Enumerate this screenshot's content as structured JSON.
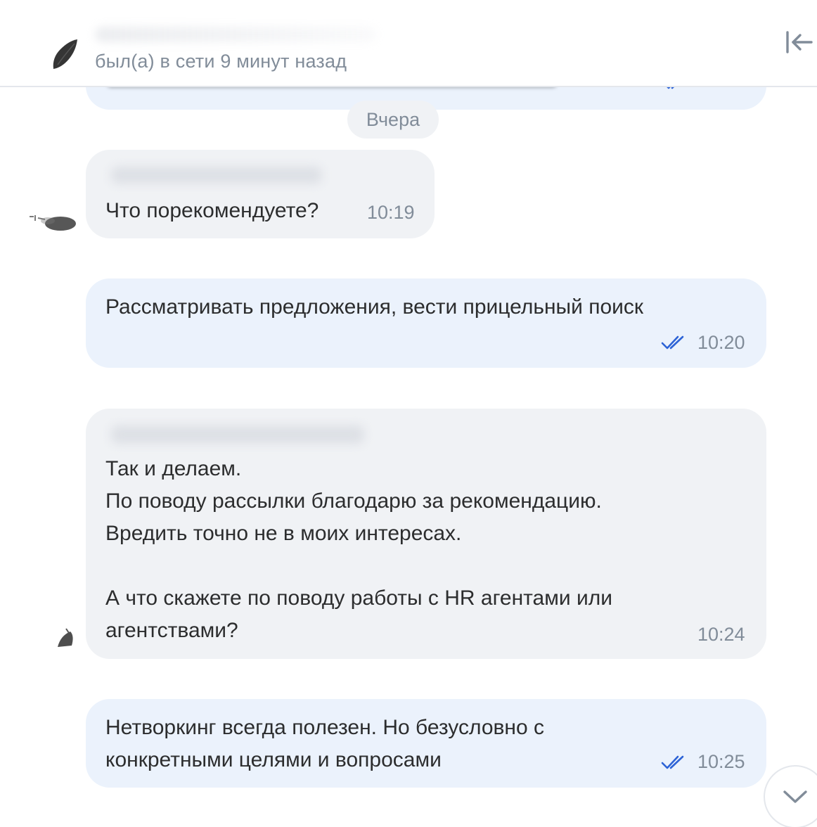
{
  "header": {
    "status": "был(а) в сети 9 минут назад"
  },
  "date_separator": "Вчера",
  "messages": [
    {
      "direction": "incoming",
      "lines": [
        "Что порекомендуете?"
      ],
      "time": "10:19"
    },
    {
      "direction": "outgoing",
      "lines": [
        "Рассматривать предложения, вести прицельный поиск"
      ],
      "time": "10:20",
      "read": true
    },
    {
      "direction": "incoming",
      "lines": [
        "Так и делаем.",
        "По поводу рассылки благодарю за рекомендацию.",
        "Вредить точно не в моих интересах.",
        "",
        "А что скажете по поводу работы с HR агентами или",
        "агентствами?"
      ],
      "time": "10:24"
    },
    {
      "direction": "outgoing",
      "lines": [
        "Нетворкинг всегда полезен. Но безусловно с",
        "конкретными целями и вопросами"
      ],
      "time": "10:25",
      "read": true
    }
  ],
  "colors": {
    "incoming_bubble": "#f0f2f5",
    "outgoing_bubble": "#ebf2fc",
    "read_check": "#2d63d6",
    "secondary_text": "#818c99"
  },
  "icons": {
    "collapse": "collapse-left-icon",
    "read": "double-check-icon",
    "scroll": "chevron-down-icon"
  }
}
